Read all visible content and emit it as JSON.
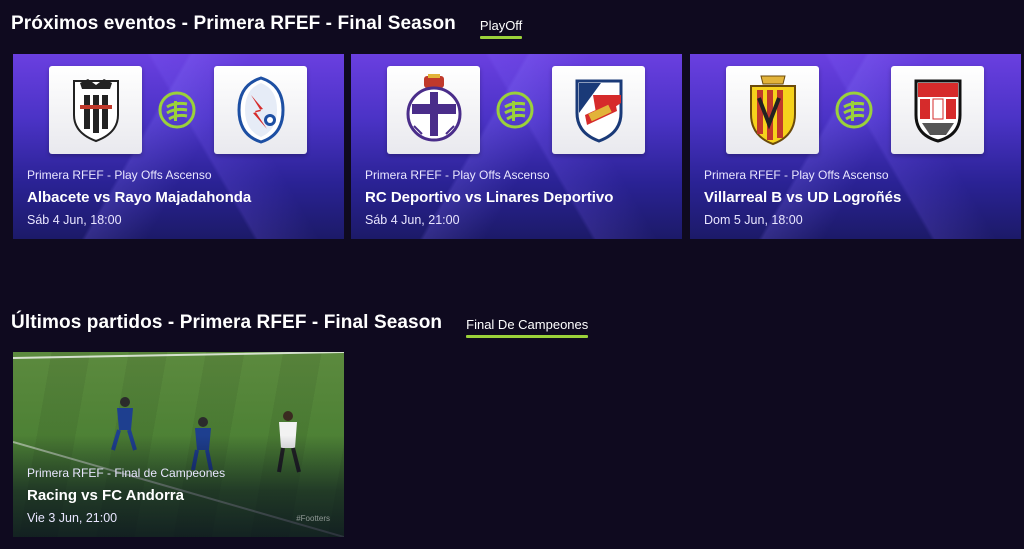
{
  "upcoming": {
    "title": "Próximos eventos - Primera RFEF - Final Season",
    "filter_label": "PlayOff",
    "cards": [
      {
        "competition": "Primera RFEF - Play Offs Ascenso",
        "match": "Albacete vs Rayo Majadahonda",
        "date": "Sáb 4 Jun, 18:00",
        "home_crest": "albacete-crest-icon",
        "away_crest": "rayo-majadahonda-crest-icon"
      },
      {
        "competition": "Primera RFEF - Play Offs Ascenso",
        "match": "RC Deportivo vs Linares Deportivo",
        "date": "Sáb 4 Jun, 21:00",
        "home_crest": "rc-deportivo-crest-icon",
        "away_crest": "linares-deportivo-crest-icon"
      },
      {
        "competition": "Primera RFEF - Play Offs Ascenso",
        "match": "Villarreal B vs UD Logroñés",
        "date": "Dom 5 Jun, 18:00",
        "home_crest": "villarreal-crest-icon",
        "away_crest": "ud-logrones-crest-icon"
      }
    ]
  },
  "latest": {
    "title": "Últimos partidos - Primera RFEF - Final Season",
    "filter_label": "Final De Campeones",
    "cards": [
      {
        "competition": "Primera RFEF - Final de Campeones",
        "match": "Racing vs FC Andorra",
        "date": "Vie 3 Jun, 21:00",
        "watermark": "#Footters"
      }
    ]
  },
  "colors": {
    "background": "#0f0a1f",
    "accent": "#9bd13a",
    "card_gradient_top": "#6a3fe0",
    "card_gradient_bottom": "#1c1a68"
  }
}
